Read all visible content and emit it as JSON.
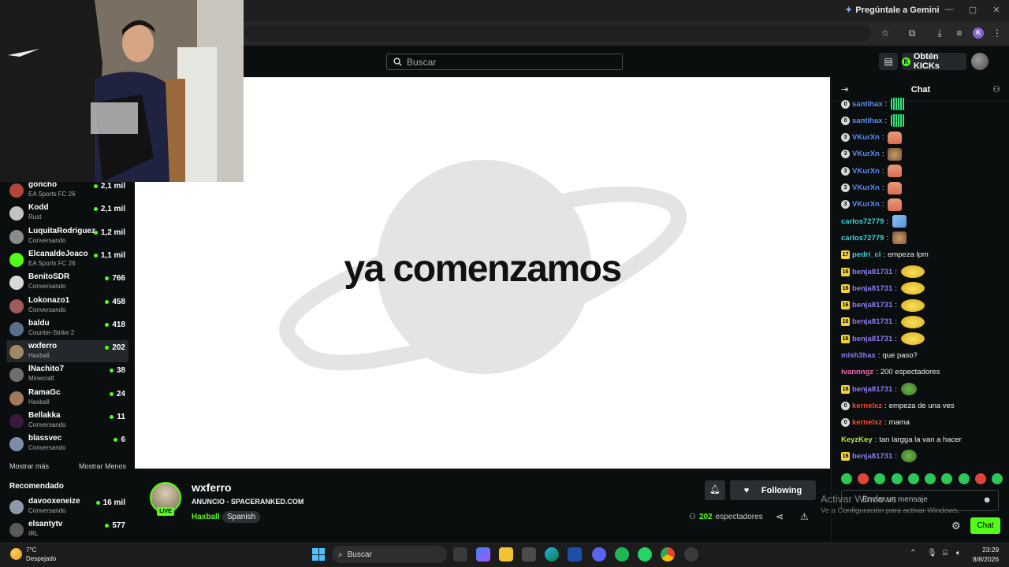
{
  "browser": {
    "gemini_label": "Pregúntale a Gemini",
    "profile_initial": "K"
  },
  "header": {
    "search_placeholder": "Buscar",
    "kicks_label": "Obtén KICKs"
  },
  "sidebar": {
    "channels": [
      {
        "name": "goncho",
        "category": "EA Sports FC 26",
        "viewers": "2,1 mil",
        "color": "#b3453b"
      },
      {
        "name": "Kodd",
        "category": "Rust",
        "viewers": "2,1 mil",
        "color": "#c2c2c2"
      },
      {
        "name": "LuquitaRodriguez",
        "category": "Conversando",
        "viewers": "1,2 mil",
        "color": "#8a8a8a"
      },
      {
        "name": "ElcanaldeJoaco",
        "category": "EA Sports FC 26",
        "viewers": "1,1 mil",
        "color": "#53fc18"
      },
      {
        "name": "BenitoSDR",
        "category": "Conversando",
        "viewers": "766",
        "color": "#d8d8d8"
      },
      {
        "name": "Lokonazo1",
        "category": "Conversando",
        "viewers": "458",
        "color": "#a05a5a"
      },
      {
        "name": "baldu",
        "category": "Counter-Strike 2",
        "viewers": "418",
        "color": "#5b6e8c"
      },
      {
        "name": "wxferro",
        "category": "Haxball",
        "viewers": "202",
        "color": "#9c8a64",
        "active": true
      },
      {
        "name": "lNachito7",
        "category": "Minecraft",
        "viewers": "38",
        "color": "#6e6e6e"
      },
      {
        "name": "RamaGc",
        "category": "Haxball",
        "viewers": "24",
        "color": "#a07a5a"
      },
      {
        "name": "Bellakka",
        "category": "Conversando",
        "viewers": "11",
        "color": "#3a1a3a"
      },
      {
        "name": "blassvec",
        "category": "Conversando",
        "viewers": "6",
        "color": "#7a8ea8"
      }
    ],
    "show_more": "Mostrar más",
    "show_less": "Mostrar Menos",
    "recommended_title": "Recomendado",
    "recommended": [
      {
        "name": "davooxeneize",
        "category": "Conversando",
        "viewers": "16 mil",
        "color": "#8a9aa8"
      },
      {
        "name": "elsantytv",
        "category": "IRL",
        "viewers": "577",
        "color": "#5a5a5a"
      }
    ]
  },
  "video": {
    "overlay_text": "ya comenzamos"
  },
  "stream": {
    "streamer": "wxferro",
    "live_badge": "LIVE",
    "title": "ANUNCIO - SPACERANKED.COM",
    "category": "Haxball",
    "language": "Spanish",
    "follow_label": "Following",
    "viewer_count": "202",
    "viewer_label": "espectadores"
  },
  "chat": {
    "title": "Chat",
    "messages": [
      {
        "badge": "0",
        "badge_type": "circle",
        "user": "santihax",
        "color": "#5b8def",
        "text": "",
        "emote": "grid"
      },
      {
        "badge": "0",
        "badge_type": "circle",
        "user": "santihax",
        "color": "#5b8def",
        "text": "",
        "emote": "grid"
      },
      {
        "badge": "3",
        "badge_type": "circle",
        "user": "VKurXn",
        "color": "#5b8def",
        "text": "",
        "emote": "hand"
      },
      {
        "badge": "3",
        "badge_type": "circle",
        "user": "VKurXn",
        "color": "#5b8def",
        "text": "",
        "emote": "cat"
      },
      {
        "badge": "3",
        "badge_type": "circle",
        "user": "VKurXn",
        "color": "#5b8def",
        "text": "",
        "emote": "hand"
      },
      {
        "badge": "3",
        "badge_type": "circle",
        "user": "VKurXn",
        "color": "#5b8def",
        "text": "",
        "emote": "hand"
      },
      {
        "badge": "3",
        "badge_type": "circle",
        "user": "VKurXn",
        "color": "#5b8def",
        "text": "",
        "emote": "hand"
      },
      {
        "badge": "",
        "badge_type": "none",
        "user": "carlos72779",
        "color": "#3fd3d8",
        "text": "",
        "emote": "blue"
      },
      {
        "badge": "",
        "badge_type": "none",
        "user": "carlos72779",
        "color": "#3fd3d8",
        "text": "",
        "emote": "cat"
      },
      {
        "badge": "17",
        "badge_type": "gold",
        "user": "pedri_cl",
        "color": "#3fd3d8",
        "text": "empeza lpm",
        "emote": ""
      },
      {
        "badge": "16",
        "badge_type": "gold",
        "user": "benja81731",
        "color": "#8f7cf0",
        "text": "",
        "emote": "chick"
      },
      {
        "badge": "16",
        "badge_type": "gold",
        "user": "benja81731",
        "color": "#8f7cf0",
        "text": "",
        "emote": "chick"
      },
      {
        "badge": "16",
        "badge_type": "gold",
        "user": "benja81731",
        "color": "#8f7cf0",
        "text": "",
        "emote": "chick"
      },
      {
        "badge": "16",
        "badge_type": "gold",
        "user": "benja81731",
        "color": "#8f7cf0",
        "text": "",
        "emote": "chick"
      },
      {
        "badge": "16",
        "badge_type": "gold",
        "user": "benja81731",
        "color": "#8f7cf0",
        "text": "",
        "emote": "chick"
      },
      {
        "badge": "",
        "badge_type": "none",
        "user": "mish3hax",
        "color": "#8f7cf0",
        "text": "que paso?",
        "emote": ""
      },
      {
        "badge": "",
        "badge_type": "none",
        "user": "ivannngz",
        "color": "#f06bb5",
        "text": "200 espectadores",
        "emote": ""
      },
      {
        "badge": "16",
        "badge_type": "gold",
        "user": "benja81731",
        "color": "#8f7cf0",
        "text": "",
        "emote": "frog"
      },
      {
        "badge": "0",
        "badge_type": "circle",
        "user": "kernelxz",
        "color": "#f04a2f",
        "text": "empeza de una ves",
        "emote": ""
      },
      {
        "badge": "0",
        "badge_type": "circle",
        "user": "kernelxz",
        "color": "#f04a2f",
        "text": "mama",
        "emote": ""
      },
      {
        "badge": "",
        "badge_type": "none",
        "user": "KeyzKey",
        "color": "#b6e84a",
        "text": "tan largga la van a hacer",
        "emote": ""
      },
      {
        "badge": "16",
        "badge_type": "gold",
        "user": "benja81731",
        "color": "#8f7cf0",
        "text": "",
        "emote": "frog"
      }
    ],
    "input_placeholder": "Enviar un mensaje",
    "send_label": "Chat"
  },
  "watermark": {
    "line1": "Activar Windows",
    "line2": "Ve a Configuración para activar Windows."
  },
  "taskbar": {
    "temperature": "7°C",
    "weather": "Despejado",
    "search_label": "Buscar",
    "time": "23:29",
    "date": "8/8/2026"
  }
}
